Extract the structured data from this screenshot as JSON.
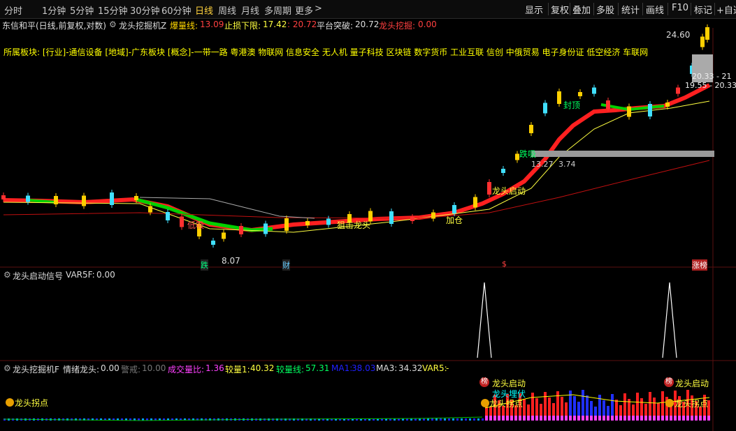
{
  "toolbar": {
    "tabs": [
      "分时",
      "1分钟",
      "5分钟",
      "15分钟",
      "30分钟",
      "60分钟",
      "日线",
      "周线",
      "月线",
      "多周期",
      "更多"
    ],
    "active_tab": "日线",
    "right_buttons": [
      "显示",
      "复权",
      "叠加",
      "多股",
      "统计",
      "画线",
      "F10",
      "标记",
      "+自选"
    ]
  },
  "main_header": {
    "stock": "东信和平(日线,前复权,对数)",
    "indicator": "龙头挖掘机Z",
    "baoliang_label": "爆量线:",
    "baoliang_value": "13.09",
    "stoploss_label": "止损下限:",
    "stoploss_value": "17.42",
    "stoploss_value2": ": 20.72",
    "breakout_label": "平台突破:",
    "breakout_value": "20.72",
    "dragon_label": "龙头挖掘:",
    "dragon_value": "0.00"
  },
  "sector_line": "所属板块: [行业]-通信设备 [地域]-广东板块 [概念]-一带一路 粤港澳 物联网 信息安全 无人机 量子科技 区块链 数字货币 工业互联 信创 中俄贸易 电子身份证 低空经济 车联网",
  "annotations": {
    "high_price": "24.60",
    "price_box1": "20.33 - 21",
    "price_box2": "19.55 - 20.33",
    "low_price": "8.07",
    "label_die": "跌",
    "label_cai": "财",
    "label_s": "$",
    "label_zhangbang": "涨榜",
    "label_dixi": "低吸",
    "label_zhuiji": "狙击龙头",
    "label_jiacang": "加仓",
    "label_longtou_qidong": "龙头启动",
    "label_diexi": "跌吸",
    "label_pos_a": "13.27",
    "label_pos_b": "3.74",
    "label_fengding": "封顶"
  },
  "panel2": {
    "title": "龙头启动信号",
    "var_label": "VAR5F:",
    "var_value": "0.00"
  },
  "panel3": {
    "title": "龙头挖掘机F",
    "mood_label": "情绪龙头:",
    "mood_value": "0.00",
    "warn_label": "警戒:",
    "warn_value": "10.00",
    "vol_ratio_label": "成交量比:",
    "vol_ratio_value": "1.36",
    "jl1_label": "较量1:",
    "jl1_value": "40.32",
    "jlx_label": "较量线:",
    "jlx_value": "57.31",
    "ma1_label": "MA1:",
    "ma1_value": "38.03",
    "ma3_label": "MA3:",
    "ma3_value": "34.32",
    "var5_label": "VAR5:",
    "var5_value": "-",
    "sig_gui_dian1": "龙头拐点",
    "sig_qidong1": "龙头启动",
    "sig_maifu": "龙头埋伏",
    "sig_gui_dian2": "龙头拐点",
    "sig_qidong2": "龙头启动",
    "sig_gui_dian3": "龙头拐点",
    "badge_bang": "榜"
  },
  "colors": {
    "up": "#ff3c3c",
    "down": "#54ffff",
    "yellow": "#ffff00",
    "green": "#00d000",
    "red_band": "#ff2020"
  }
}
